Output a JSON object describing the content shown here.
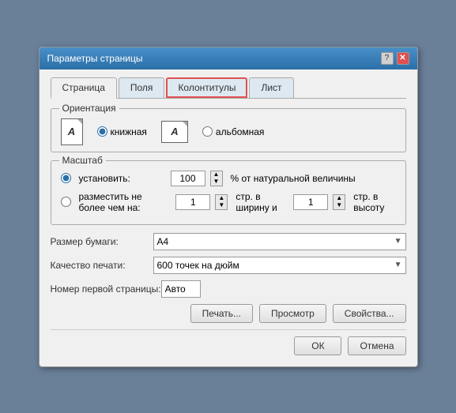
{
  "dialog": {
    "title": "Параметры страницы",
    "tabs": [
      {
        "id": "stranica",
        "label": "Страница",
        "active": true,
        "highlighted": false
      },
      {
        "id": "polya",
        "label": "Поля",
        "active": false,
        "highlighted": false
      },
      {
        "id": "kolontituly",
        "label": "Колонтитулы",
        "active": false,
        "highlighted": true
      },
      {
        "id": "list",
        "label": "Лист",
        "active": false,
        "highlighted": false
      }
    ],
    "orientation_group_label": "Ориентация",
    "orientations": [
      {
        "id": "portrait",
        "label": "книжная",
        "checked": true
      },
      {
        "id": "landscape",
        "label": "альбомная",
        "checked": false
      }
    ],
    "scale_group_label": "Масштаб",
    "scale_set_label": "установить:",
    "scale_value": "100",
    "scale_unit": "% от натуральной величины",
    "scale_fit_label": "разместить не более чем на:",
    "scale_fit_width_value": "1",
    "scale_fit_width_unit": "стр. в ширину и",
    "scale_fit_height_value": "1",
    "scale_fit_height_unit": "стр. в высоту",
    "paper_size_label": "Размер бумаги:",
    "paper_size_value": "A4",
    "print_quality_label": "Качество печати:",
    "print_quality_value": "600 точек на дюйм",
    "first_page_label": "Номер первой страницы:",
    "first_page_value": "Авто",
    "buttons": {
      "print": "Печать...",
      "preview": "Просмотр",
      "properties": "Свойства...",
      "ok": "ОК",
      "cancel": "Отмена"
    }
  }
}
